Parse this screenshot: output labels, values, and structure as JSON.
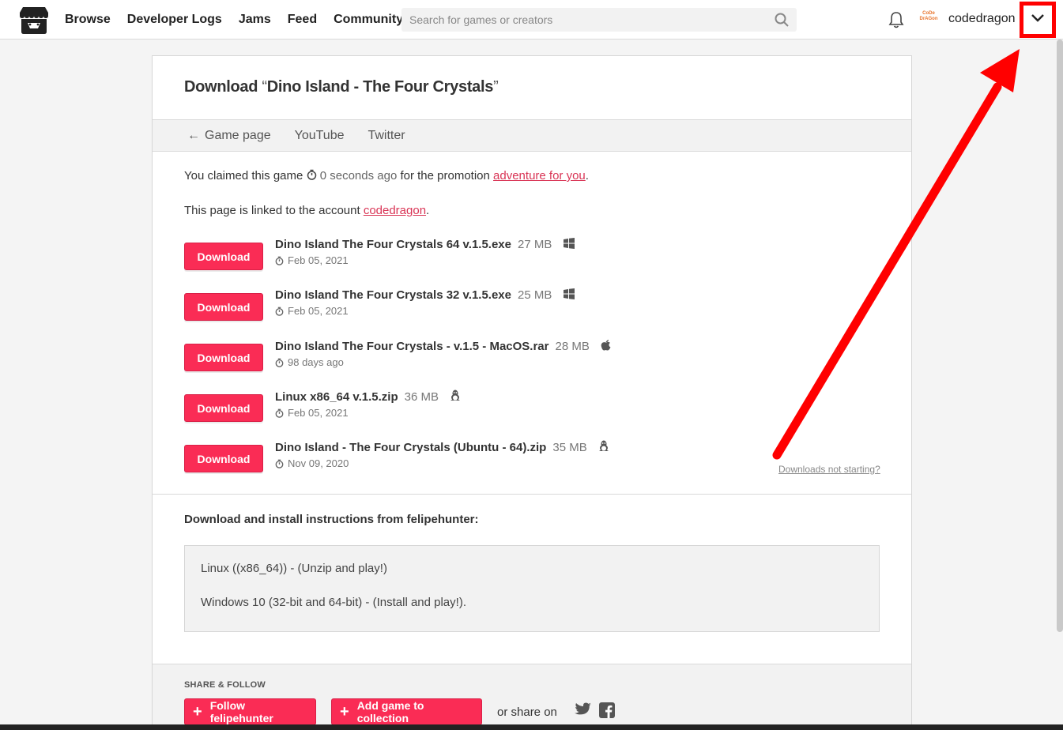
{
  "header": {
    "nav": [
      "Browse",
      "Developer Logs",
      "Jams",
      "Feed",
      "Community"
    ],
    "search_placeholder": "Search for games or creators",
    "avatar_text": "CoDe DrAGon",
    "username": "codedragon"
  },
  "page": {
    "title_prefix": "Download ",
    "title_open_quote": "“",
    "title_game": "Dino Island - The Four Crystals",
    "title_close_quote": "”",
    "tabs": [
      "Game page",
      "YouTube",
      "Twitter"
    ],
    "claim": {
      "prefix": "You claimed this game ",
      "time": "0 seconds ago",
      "middle": " for the promotion ",
      "promo": "adventure for you",
      "suffix": "."
    },
    "linked": {
      "prefix": "This page is linked to the account ",
      "account": "codedragon",
      "suffix": "."
    },
    "download_label": "Download",
    "uploads": [
      {
        "name": "Dino Island The Four Crystals 64 v.1.5.exe",
        "size": "27 MB",
        "platform": "windows",
        "date": "Feb 05, 2021"
      },
      {
        "name": "Dino Island The Four Crystals 32 v.1.5.exe",
        "size": "25 MB",
        "platform": "windows",
        "date": "Feb 05, 2021"
      },
      {
        "name": "Dino Island The Four Crystals - v.1.5 - MacOS.rar",
        "size": "28 MB",
        "platform": "apple",
        "date": "98 days ago"
      },
      {
        "name": "Linux x86_64 v.1.5.zip",
        "size": "36 MB",
        "platform": "linux",
        "date": "Feb 05, 2021"
      },
      {
        "name": "Dino Island - The Four Crystals (Ubuntu - 64).zip",
        "size": "35 MB",
        "platform": "linux",
        "date": "Nov 09, 2020"
      }
    ],
    "not_starting": "Downloads not starting?",
    "instructions_title": "Download and install instructions from felipehunter:",
    "instructions": [
      "Linux ((x86_64)) - (Unzip and play!)",
      "Windows 10 (32-bit and 64-bit) - (Install and play!)."
    ],
    "share_title": "SHARE & FOLLOW",
    "follow_label": "Follow felipehunter",
    "collection_label": "Add game to collection",
    "share_on": "or share on"
  },
  "colors": {
    "accent": "#fa2c55",
    "highlight": "#ff0000",
    "link": "#d93455"
  }
}
